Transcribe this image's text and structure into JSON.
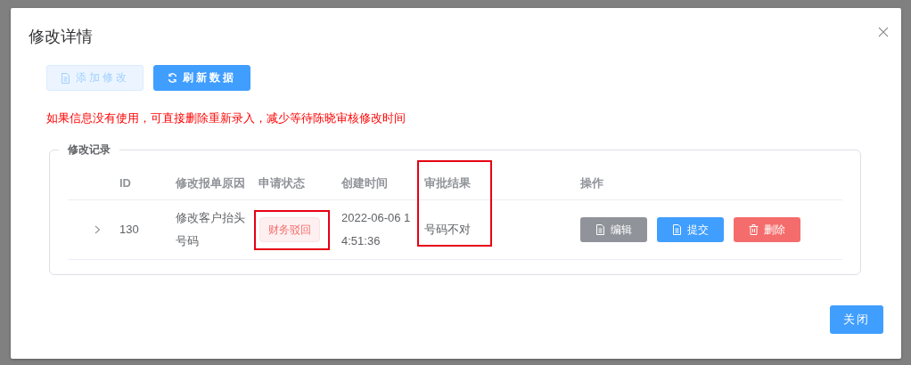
{
  "dialog": {
    "title": "修改详情",
    "toolbar": [
      {
        "kind": "add",
        "label": "添加修改",
        "disabled": true
      },
      {
        "kind": "refresh",
        "label": "刷新数据",
        "disabled": false
      }
    ],
    "notice": "如果信息没有使用，可直接删除重新录入，减少等待陈晓审核修改时间",
    "section": {
      "legend": "修改记录",
      "columns": [
        {
          "label": "ID",
          "highlighted": false
        },
        {
          "label": "修改报单原因",
          "highlighted": false
        },
        {
          "label": "申请状态",
          "highlighted": false
        },
        {
          "label": "创建时间",
          "highlighted": false
        },
        {
          "label": "审批结果",
          "highlighted": true
        },
        {
          "label": "操作",
          "highlighted": false
        }
      ],
      "rows": [
        {
          "expanded": false,
          "id": "130",
          "reason": "修改客户抬头号码",
          "status": {
            "label": "财务驳回",
            "highlighted": true
          },
          "created": "2022-06-06 14:51:36",
          "result": "号码不对",
          "actions": [
            {
              "kind": "edit",
              "label": "编辑"
            },
            {
              "kind": "submit",
              "label": "提交"
            },
            {
              "kind": "delete",
              "label": "删除"
            }
          ]
        }
      ]
    },
    "footer_buttons": [
      {
        "kind": "primary",
        "label": "关闭"
      }
    ]
  }
}
